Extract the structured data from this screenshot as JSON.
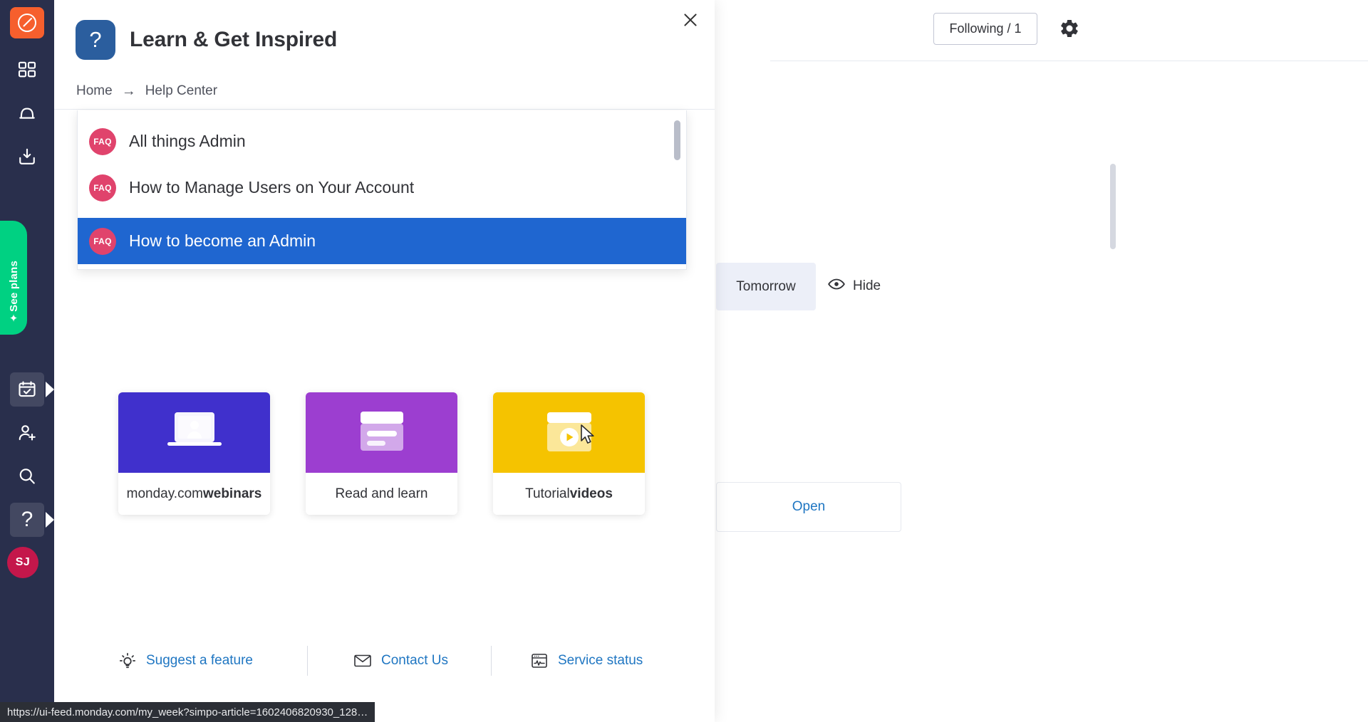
{
  "colors": {
    "rail_bg": "#292f4c",
    "logo_orange": "#f65f2d",
    "see_plans_green": "#00d182",
    "avatar_pink": "#c4174b",
    "faq_chip_pink": "#e0436c",
    "selected_blue": "#1f66d0",
    "help_badge_blue": "#2b5e9e",
    "link_blue": "#1f76c2",
    "card_webinars": "#4030cc",
    "card_read": "#9c3ed0",
    "card_video": "#f5c300"
  },
  "rail": {
    "logo_name": "monday-logo-icon",
    "items": [
      {
        "name": "home-grid-icon",
        "label": "Home"
      },
      {
        "name": "bell-notifications-icon",
        "label": "Notifications"
      },
      {
        "name": "inbox-download-icon",
        "label": "Inbox"
      }
    ],
    "see_plans_label": "See plans",
    "lower_items": [
      {
        "name": "my-week-calendar-icon",
        "label": "My Week",
        "active": true
      },
      {
        "name": "invite-member-icon",
        "label": "Invite members"
      },
      {
        "name": "search-icon",
        "label": "Search"
      },
      {
        "name": "help-question-icon",
        "label": "Help",
        "active": true
      }
    ],
    "avatar_initials": "SJ"
  },
  "background": {
    "following_label": "Following / 1",
    "gear_icon": "gear-icon",
    "tomorrow_label": "Tomorrow",
    "hide_label": "Hide",
    "hide_icon": "eye-hide-icon",
    "open_label": "Open"
  },
  "modal": {
    "close_icon": "close-icon",
    "badge_glyph": "?",
    "title": "Learn & Get Inspired",
    "breadcrumb": {
      "home": "Home",
      "arrow": "→",
      "current": "Help Center"
    },
    "faq_results": [
      {
        "chip": "FAQ",
        "title": "All things Admin",
        "selected": false
      },
      {
        "chip": "FAQ",
        "title": "How to Manage Users on Your Account",
        "selected": false
      },
      {
        "chip": "FAQ",
        "title": "How to become an Admin",
        "selected": true
      }
    ],
    "cards": [
      {
        "icon": "webinar-laptop-icon",
        "label_plain": "monday.com ",
        "label_bold": "webinars",
        "color": "#4030cc"
      },
      {
        "icon": "article-read-icon",
        "label_plain": "Read and learn",
        "label_bold": "",
        "color": "#9c3ed0"
      },
      {
        "icon": "video-play-icon",
        "label_plain": "Tutorial ",
        "label_bold": "videos",
        "color": "#f5c300"
      }
    ],
    "footer_links": [
      {
        "icon": "lightbulb-icon",
        "label": "Suggest a feature"
      },
      {
        "icon": "envelope-icon",
        "label": "Contact Us"
      },
      {
        "icon": "service-status-icon",
        "label": "Service status"
      }
    ]
  },
  "statusbar": {
    "url": "https://ui-feed.monday.com/my_week?simpo-article=1602406820930_128…"
  }
}
